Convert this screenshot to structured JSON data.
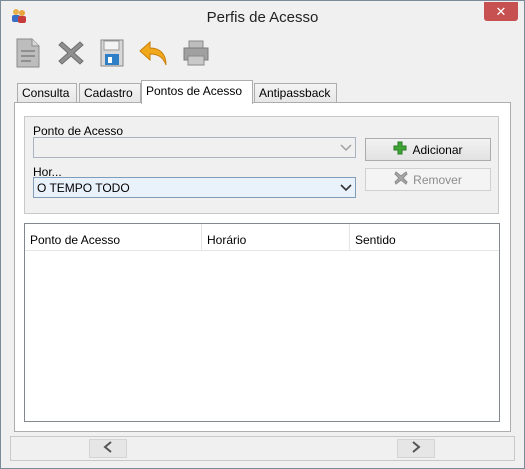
{
  "window": {
    "title": "Perfis de Acesso",
    "close_glyph": "✕"
  },
  "toolbar": {
    "buttons": [
      {
        "icon": "document-icon",
        "tooltip": ""
      },
      {
        "icon": "delete-x-icon",
        "tooltip": ""
      },
      {
        "icon": "save-floppy-icon",
        "tooltip": ""
      },
      {
        "icon": "undo-arrow-icon",
        "tooltip": ""
      },
      {
        "icon": "print-icon",
        "tooltip": ""
      }
    ]
  },
  "tabs": [
    {
      "label": "Consulta",
      "active": false
    },
    {
      "label": "Cadastro",
      "active": false
    },
    {
      "label": "Pontos de Acesso",
      "active": true
    },
    {
      "label": "Antipassback",
      "active": false
    }
  ],
  "form": {
    "ponto_label": "Ponto de Acesso",
    "ponto_value": "",
    "horario_label": "Hor...",
    "horario_value": "O TEMPO TODO",
    "add_label": "Adicionar",
    "remove_label": "Remover"
  },
  "grid": {
    "columns": [
      "Ponto de Acesso",
      "Horário",
      "Sentido"
    ],
    "rows": []
  },
  "colors": {
    "add_icon": "#3fa535",
    "close_button": "#c75050",
    "undo_arrow": "#f2a81d"
  }
}
